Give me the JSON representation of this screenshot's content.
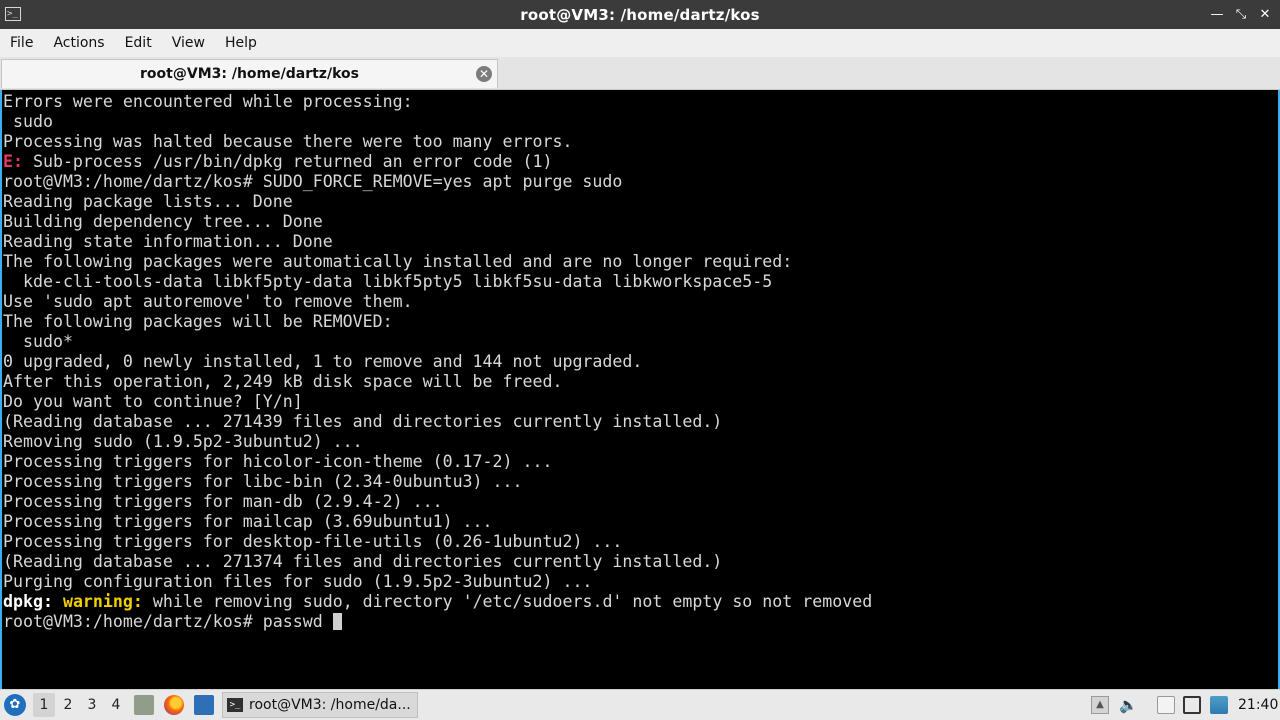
{
  "window": {
    "title": "root@VM3: /home/dartz/kos",
    "app_icon": "terminal-icon",
    "buttons": [
      "minimize-icon",
      "maximize-icon",
      "close-icon"
    ]
  },
  "menu": {
    "items": [
      "File",
      "Actions",
      "Edit",
      "View",
      "Help"
    ]
  },
  "tab": {
    "label": "root@VM3: /home/dartz/kos",
    "close_icon": "close-circle-icon"
  },
  "terminal": {
    "colors": {
      "background": "#000000",
      "text": "#d8d8d8",
      "error": "#e8375f",
      "warning": "#f0d000",
      "accent_border": "#3daee9"
    },
    "lines": [
      [
        {
          "t": "Errors were encountered while processing:"
        }
      ],
      [
        {
          "t": " sudo"
        }
      ],
      [
        {
          "t": "Processing was halted because there were too many errors."
        }
      ],
      [
        {
          "t": "E:",
          "s": "err"
        },
        {
          "t": " Sub-process /usr/bin/dpkg returned an error code (1)"
        }
      ],
      [
        {
          "t": "root@VM3:/home/dartz/kos# SUDO_FORCE_REMOVE=yes apt purge sudo"
        }
      ],
      [
        {
          "t": "Reading package lists... Done"
        }
      ],
      [
        {
          "t": "Building dependency tree... Done"
        }
      ],
      [
        {
          "t": "Reading state information... Done"
        }
      ],
      [
        {
          "t": "The following packages were automatically installed and are no longer required:"
        }
      ],
      [
        {
          "t": "  kde-cli-tools-data libkf5pty-data libkf5pty5 libkf5su-data libkworkspace5-5"
        }
      ],
      [
        {
          "t": "Use 'sudo apt autoremove' to remove them."
        }
      ],
      [
        {
          "t": "The following packages will be REMOVED:"
        }
      ],
      [
        {
          "t": "  sudo*"
        }
      ],
      [
        {
          "t": "0 upgraded, 0 newly installed, 1 to remove and 144 not upgraded."
        }
      ],
      [
        {
          "t": "After this operation, 2,249 kB disk space will be freed."
        }
      ],
      [
        {
          "t": "Do you want to continue? [Y/n]"
        }
      ],
      [
        {
          "t": "(Reading database ... 271439 files and directories currently installed.)"
        }
      ],
      [
        {
          "t": "Removing sudo (1.9.5p2-3ubuntu2) ..."
        }
      ],
      [
        {
          "t": "Processing triggers for hicolor-icon-theme (0.17-2) ..."
        }
      ],
      [
        {
          "t": "Processing triggers for libc-bin (2.34-0ubuntu3) ..."
        }
      ],
      [
        {
          "t": "Processing triggers for man-db (2.9.4-2) ..."
        }
      ],
      [
        {
          "t": "Processing triggers for mailcap (3.69ubuntu1) ..."
        }
      ],
      [
        {
          "t": "Processing triggers for desktop-file-utils (0.26-1ubuntu2) ..."
        }
      ],
      [
        {
          "t": "(Reading database ... 271374 files and directories currently installed.)"
        }
      ],
      [
        {
          "t": "Purging configuration files for sudo (1.9.5p2-3ubuntu2) ..."
        }
      ],
      [
        {
          "t": "dpkg:",
          "s": "bold"
        },
        {
          "t": " "
        },
        {
          "t": "warning:",
          "s": "warn"
        },
        {
          "t": " while removing sudo, directory '/etc/sudoers.d' not empty so not removed"
        }
      ],
      [
        {
          "t": "root@VM3:/home/dartz/kos# passwd "
        },
        {
          "cursor": true
        }
      ]
    ]
  },
  "taskbar": {
    "launcher_icon": "app-launcher-icon",
    "desktops": [
      "1",
      "2",
      "3",
      "4"
    ],
    "active_desktop": "1",
    "quicklaunch": [
      "file-manager-icon",
      "firefox-icon",
      "terminal-launcher-icon"
    ],
    "task_label": "root@VM3: /home/da...",
    "tray": [
      "tray-expand-icon",
      "volume-icon",
      "clipboard-icon",
      "display-icon",
      "network-icon"
    ],
    "clock": "21:40"
  }
}
